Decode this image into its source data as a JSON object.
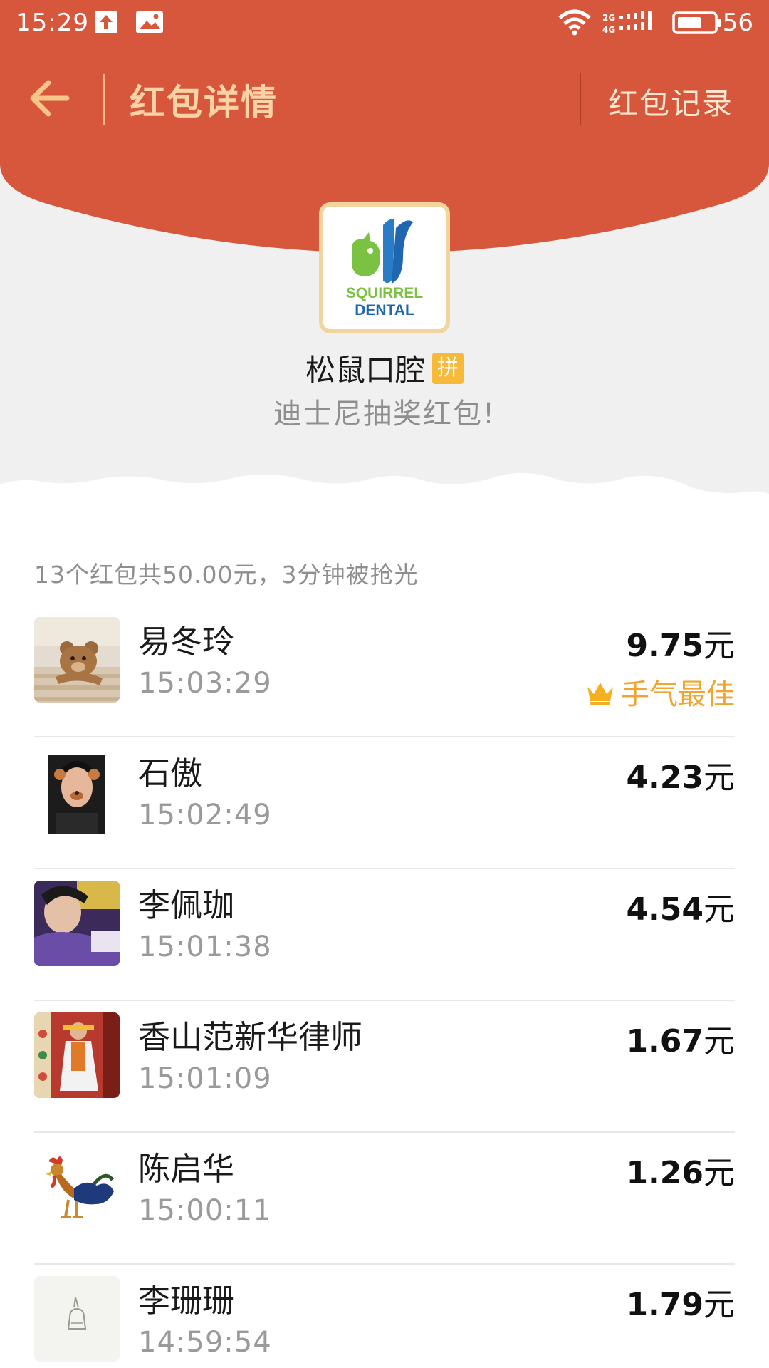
{
  "status_bar": {
    "time": "15:29",
    "network": "2G 4G",
    "battery": "56"
  },
  "nav": {
    "title": "红包详情",
    "record_label": "红包记录"
  },
  "brand": {
    "name": "松鼠口腔",
    "badge": "拼",
    "slogan": "迪士尼抽奖红包!",
    "logo_line1": "SQUIRREL",
    "logo_line2": "DENTAL"
  },
  "summary": "13个红包共50.00元，3分钟被抢光",
  "currency_unit": "元",
  "best_label": "手气最佳",
  "recipients": [
    {
      "name": "易冬玲",
      "time": "15:03:29",
      "amount": "9.75",
      "best": true
    },
    {
      "name": "石傲",
      "time": "15:02:49",
      "amount": "4.23",
      "best": false
    },
    {
      "name": "李佩珈",
      "time": "15:01:38",
      "amount": "4.54",
      "best": false
    },
    {
      "name": "香山范新华律师",
      "time": "15:01:09",
      "amount": "1.67",
      "best": false
    },
    {
      "name": "陈启华",
      "time": "15:00:11",
      "amount": "1.26",
      "best": false
    },
    {
      "name": "李珊珊",
      "time": "14:59:54",
      "amount": "1.79",
      "best": false
    }
  ],
  "colors": {
    "header_red": "#d6573c",
    "title_gold": "#f9d3a6",
    "best_orange": "#f0a431",
    "background_grey": "#f0f0f0"
  }
}
